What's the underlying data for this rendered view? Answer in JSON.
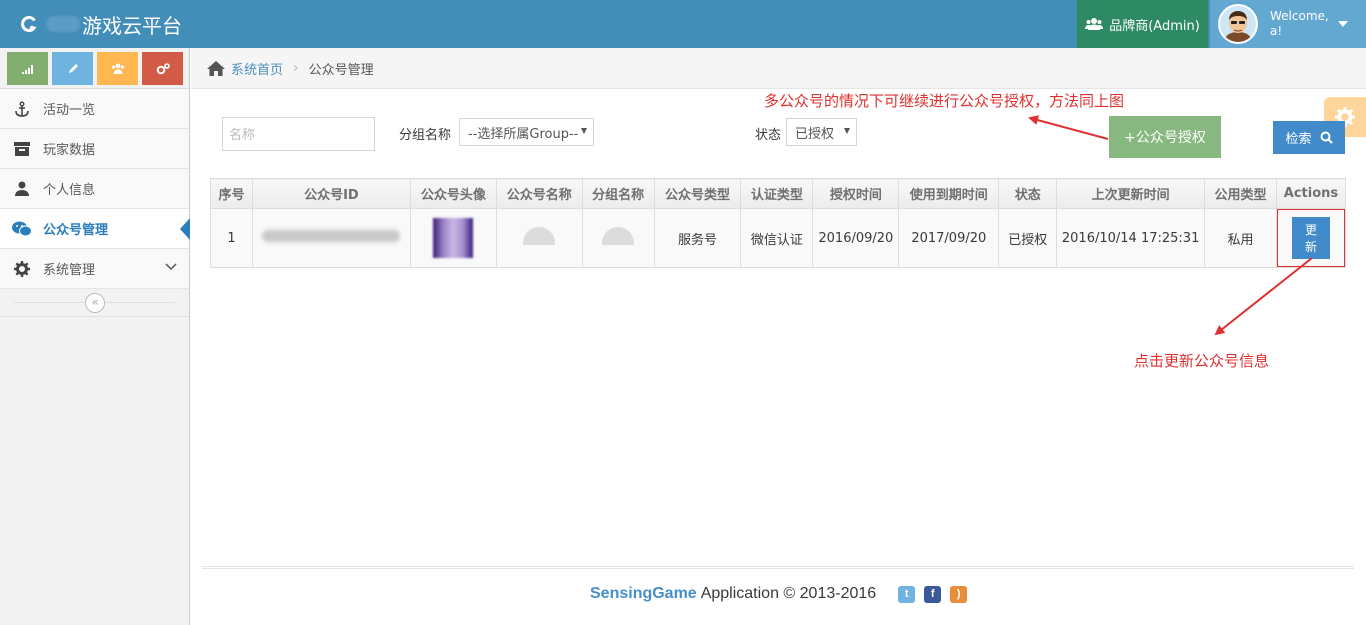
{
  "header": {
    "app_title": "游戏云平台",
    "brand_owner": "品牌商(Admin)",
    "welcome": "Welcome,",
    "username": "a!"
  },
  "sidebar": {
    "items": [
      {
        "label": "活动一览",
        "icon": "anchor-icon"
      },
      {
        "label": "玩家数据",
        "icon": "archive-icon"
      },
      {
        "label": "个人信息",
        "icon": "user-icon"
      },
      {
        "label": "公众号管理",
        "icon": "wechat-icon",
        "active": true
      },
      {
        "label": "系统管理",
        "icon": "cogs-icon"
      }
    ],
    "shortcut_colors": [
      "#82af6f",
      "#6fb3e0",
      "#ffb752",
      "#d15b47"
    ]
  },
  "breadcrumb": {
    "home": "系统首页",
    "current": "公众号管理"
  },
  "annotations": {
    "top": "多公众号的情况下可继续进行公众号授权，方法同上图",
    "bottom": "点击更新公众号信息"
  },
  "filters": {
    "name_placeholder": "名称",
    "group_label": "分组名称",
    "group_select": "--选择所属Group--",
    "status_label": "状态",
    "status_select": "已授权",
    "authorize_button": "+公众号授权",
    "search_button": "检索"
  },
  "table": {
    "headers": [
      "序号",
      "公众号ID",
      "公众号头像",
      "公众号名称",
      "分组名称",
      "公众号类型",
      "认证类型",
      "授权时间",
      "使用到期时间",
      "状态",
      "上次更新时间",
      "公用类型",
      "Actions"
    ],
    "rows": [
      {
        "index": "1",
        "type": "服务号",
        "verify": "微信认证",
        "auth_time": "2016/09/20",
        "expire_time": "2017/09/20",
        "status": "已授权",
        "updated": "2016/10/14 17:25:31",
        "share_type": "私用",
        "action": "更新"
      }
    ]
  },
  "footer": {
    "brand": "SensingGame",
    "text": "Application © 2013-2016"
  },
  "colors": {
    "navbar": "#438eb9",
    "brand_owner_bg": "#2e8965",
    "user_bg": "#62a8d1",
    "primary": "#428bca",
    "success": "#87b87f",
    "annotation": "#e03030"
  }
}
